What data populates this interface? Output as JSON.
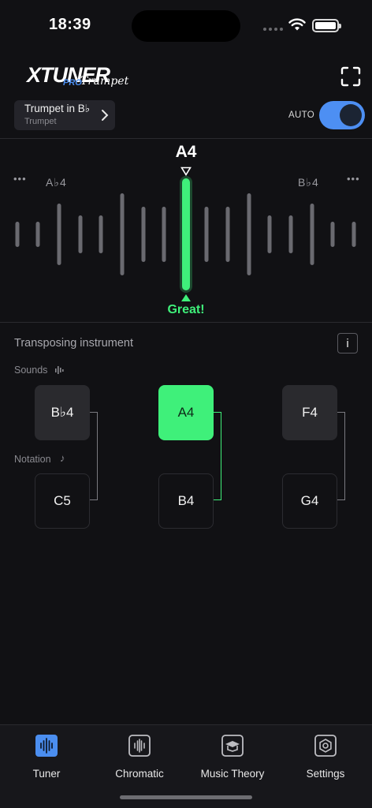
{
  "status": {
    "time": "18:39"
  },
  "logo": {
    "main": "XTUNER",
    "pro": "PRO",
    "sub": "Trumpet"
  },
  "instrument": {
    "name": "Trumpet in B♭",
    "sub": "Trumpet"
  },
  "auto": {
    "label": "AUTO",
    "on": true
  },
  "meter": {
    "note": "A4",
    "flat_label": "A♭4",
    "sharp_label": "B♭4",
    "dots": "•••",
    "feedback": "Great!",
    "active_color": "#3ff07a"
  },
  "transpose": {
    "title": "Transposing instrument",
    "info": "i",
    "sounds_label": "Sounds",
    "notation_label": "Notation",
    "notation_icon": "♪",
    "pairs": [
      {
        "sound": "B♭4",
        "notation": "C5",
        "active": false
      },
      {
        "sound": "A4",
        "notation": "B4",
        "active": true
      },
      {
        "sound": "F4",
        "notation": "G4",
        "active": false
      }
    ]
  },
  "tabs": [
    {
      "label": "Tuner",
      "icon": "tuner-icon",
      "active": true
    },
    {
      "label": "Chromatic",
      "icon": "chromatic-icon",
      "active": false
    },
    {
      "label": "Music Theory",
      "icon": "music-theory-icon",
      "active": false
    },
    {
      "label": "Settings",
      "icon": "settings-icon",
      "active": false
    }
  ],
  "colors": {
    "accent": "#3ff07a",
    "toggle": "#4d8ff3",
    "tab_active": "#4b8ef0"
  }
}
